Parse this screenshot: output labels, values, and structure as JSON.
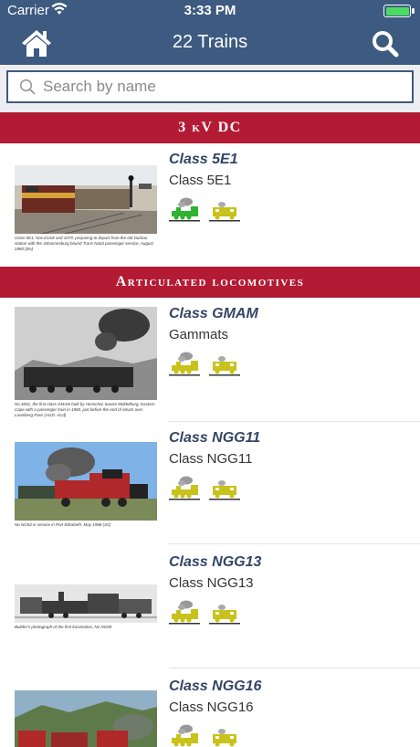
{
  "status": {
    "carrier": "Carrier",
    "time": "3:33 PM"
  },
  "nav": {
    "title": "22 Trains"
  },
  "search": {
    "placeholder": "Search by name"
  },
  "sections": [
    {
      "title": "3 kV DC"
    },
    {
      "title": "Articulated locomotives"
    }
  ],
  "trains": [
    {
      "name": "Class 5E1",
      "subtitle": "Class 5E1",
      "caption": "Class 5E1, Nos.E1mk and 1079, preparing to depart from the old Durban station with the Johannesburg bound Trans Natal passenger service, August 1980 (BA)",
      "badges": [
        "steam-green",
        "diesel-yellow"
      ]
    },
    {
      "name": "Class GMAM",
      "subtitle": "Gammats",
      "caption": "No 4051, the first class GMAM built by Henschel, leaves Middelburg, Eastern Cape with a passenger train in 1960, just before the end of steam over Lootsberg Pass (AGD: ACd)",
      "badges": [
        "steam-yellow",
        "diesel-yellow"
      ]
    },
    {
      "name": "Class NGG11",
      "subtitle": "Class NGG11",
      "caption": "No NG54 in service in Port Elizabeth, May 1986 (JG)",
      "badges": [
        "steam-yellow",
        "diesel-yellow"
      ]
    },
    {
      "name": "Class NGG13",
      "subtitle": "Class NGG13",
      "caption": "Builder's photograph of the first locomotive, No NG59",
      "badges": [
        "steam-yellow",
        "diesel-yellow"
      ]
    },
    {
      "name": "Class NGG16",
      "subtitle": "Class NGG16",
      "caption": "",
      "badges": [
        "steam-yellow",
        "diesel-yellow"
      ]
    }
  ],
  "colors": {
    "nav": "#3d5a80",
    "section": "#b31b34",
    "badge_green": "#2fb32f",
    "badge_yellow": "#c8c21a"
  }
}
